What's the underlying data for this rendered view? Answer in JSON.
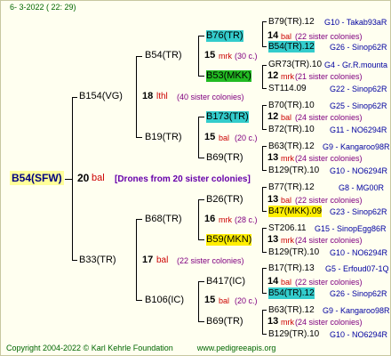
{
  "header": {
    "date": "6-  3-2022 ( 22: 29)"
  },
  "footer": {
    "copyright": "Copyright 2004-2022 © Karl Kehrle Foundation",
    "url": "www.pedigreeapis.org"
  },
  "root": {
    "name": "B54(SFW)",
    "num": "20",
    "mark": "bal",
    "note": "[Drones from 20 sister colonies]"
  },
  "gen1": [
    {
      "name": "B154(VG)",
      "num": "18",
      "mark": "lthl",
      "note": "(40 sister colonies)"
    },
    {
      "name": "B33(TR)",
      "num": "17",
      "mark": "bal",
      "note": "(22 sister colonies)"
    }
  ],
  "gen2": [
    {
      "name": "B54(TR)",
      "num": "15",
      "mark": "mrk",
      "note": "(30 c.)"
    },
    {
      "name": "B19(TR)",
      "num": "15",
      "mark": "bal",
      "note": "(20 c.)"
    },
    {
      "name": "B68(TR)",
      "num": "16",
      "mark": "mrk",
      "note": "(28 c.)"
    },
    {
      "name": "B106(IC)",
      "num": "15",
      "mark": "bal",
      "note": "(20 c.)"
    }
  ],
  "gen3": [
    {
      "name": "B76(TR)",
      "num": "14",
      "mark": "bal",
      "note": "(22 sister colonies)"
    },
    {
      "name": "B53(MKK)",
      "num": "12",
      "mark": "mrk",
      "note": "(21 sister colonies)"
    },
    {
      "name": "B173(TR)",
      "num": "12",
      "mark": "bal",
      "note": "(24 sister colonies)"
    },
    {
      "name": "B69(TR)",
      "num": "13",
      "mark": "mrk",
      "note": "(24 sister colonies)"
    },
    {
      "name": "B26(TR)",
      "num": "13",
      "mark": "bal",
      "note": "(22 sister colonies)"
    },
    {
      "name": "B59(MKN)",
      "num": "13",
      "mark": "mrk",
      "note": "(24 sister colonies)"
    },
    {
      "name": "B417(IC)",
      "num": "14",
      "mark": "bal",
      "note": "(22 sister colonies)"
    },
    {
      "name": "B69(TR)",
      "num": "13",
      "mark": "mrk",
      "note": "(24 sister colonies)"
    }
  ],
  "gen4": [
    {
      "name": "B79(TR).12",
      "info": "G10 - Takab93aR"
    },
    {
      "name": "B54(TR).12",
      "info": "G26 - Sinop62R"
    },
    {
      "name": "GR73(TR).10",
      "info": "G4 - Gr.R.mounta"
    },
    {
      "name": "ST114.09",
      "info": "G22 - Sinop62R"
    },
    {
      "name": "B70(TR).10",
      "info": "G25 - Sinop62R"
    },
    {
      "name": "B72(TR).10",
      "info": "G11 - NO6294R"
    },
    {
      "name": "B63(TR).12",
      "info": "G9 - Kangaroo98R"
    },
    {
      "name": "B129(TR).10",
      "info": "G10 - NO6294R"
    },
    {
      "name": "B77(TR).12",
      "info": "G8 - MG00R"
    },
    {
      "name": "B47(MKK).09",
      "info": "G23 - Sinop62R"
    },
    {
      "name": "ST206.11",
      "info": "G15 - SinopEgg86R"
    },
    {
      "name": "B129(TR).10",
      "info": "G10 - NO6294R"
    },
    {
      "name": "B17(TR).13",
      "info": "G5 - Erfoud07-1Q"
    },
    {
      "name": "B54(TR).12",
      "info": "G26 - Sinop62R"
    },
    {
      "name": "B63(TR).12",
      "info": "G9 - Kangaroo98R"
    },
    {
      "name": "B129(TR).10",
      "info": "G10 - NO6294R"
    }
  ],
  "colors": {
    "background": "#fffff0",
    "mark": "#cc0000",
    "note": "#800080",
    "info": "#0000a0",
    "cyan": "#33cccc",
    "green": "#22bb22",
    "yellow": "#ffee00"
  }
}
